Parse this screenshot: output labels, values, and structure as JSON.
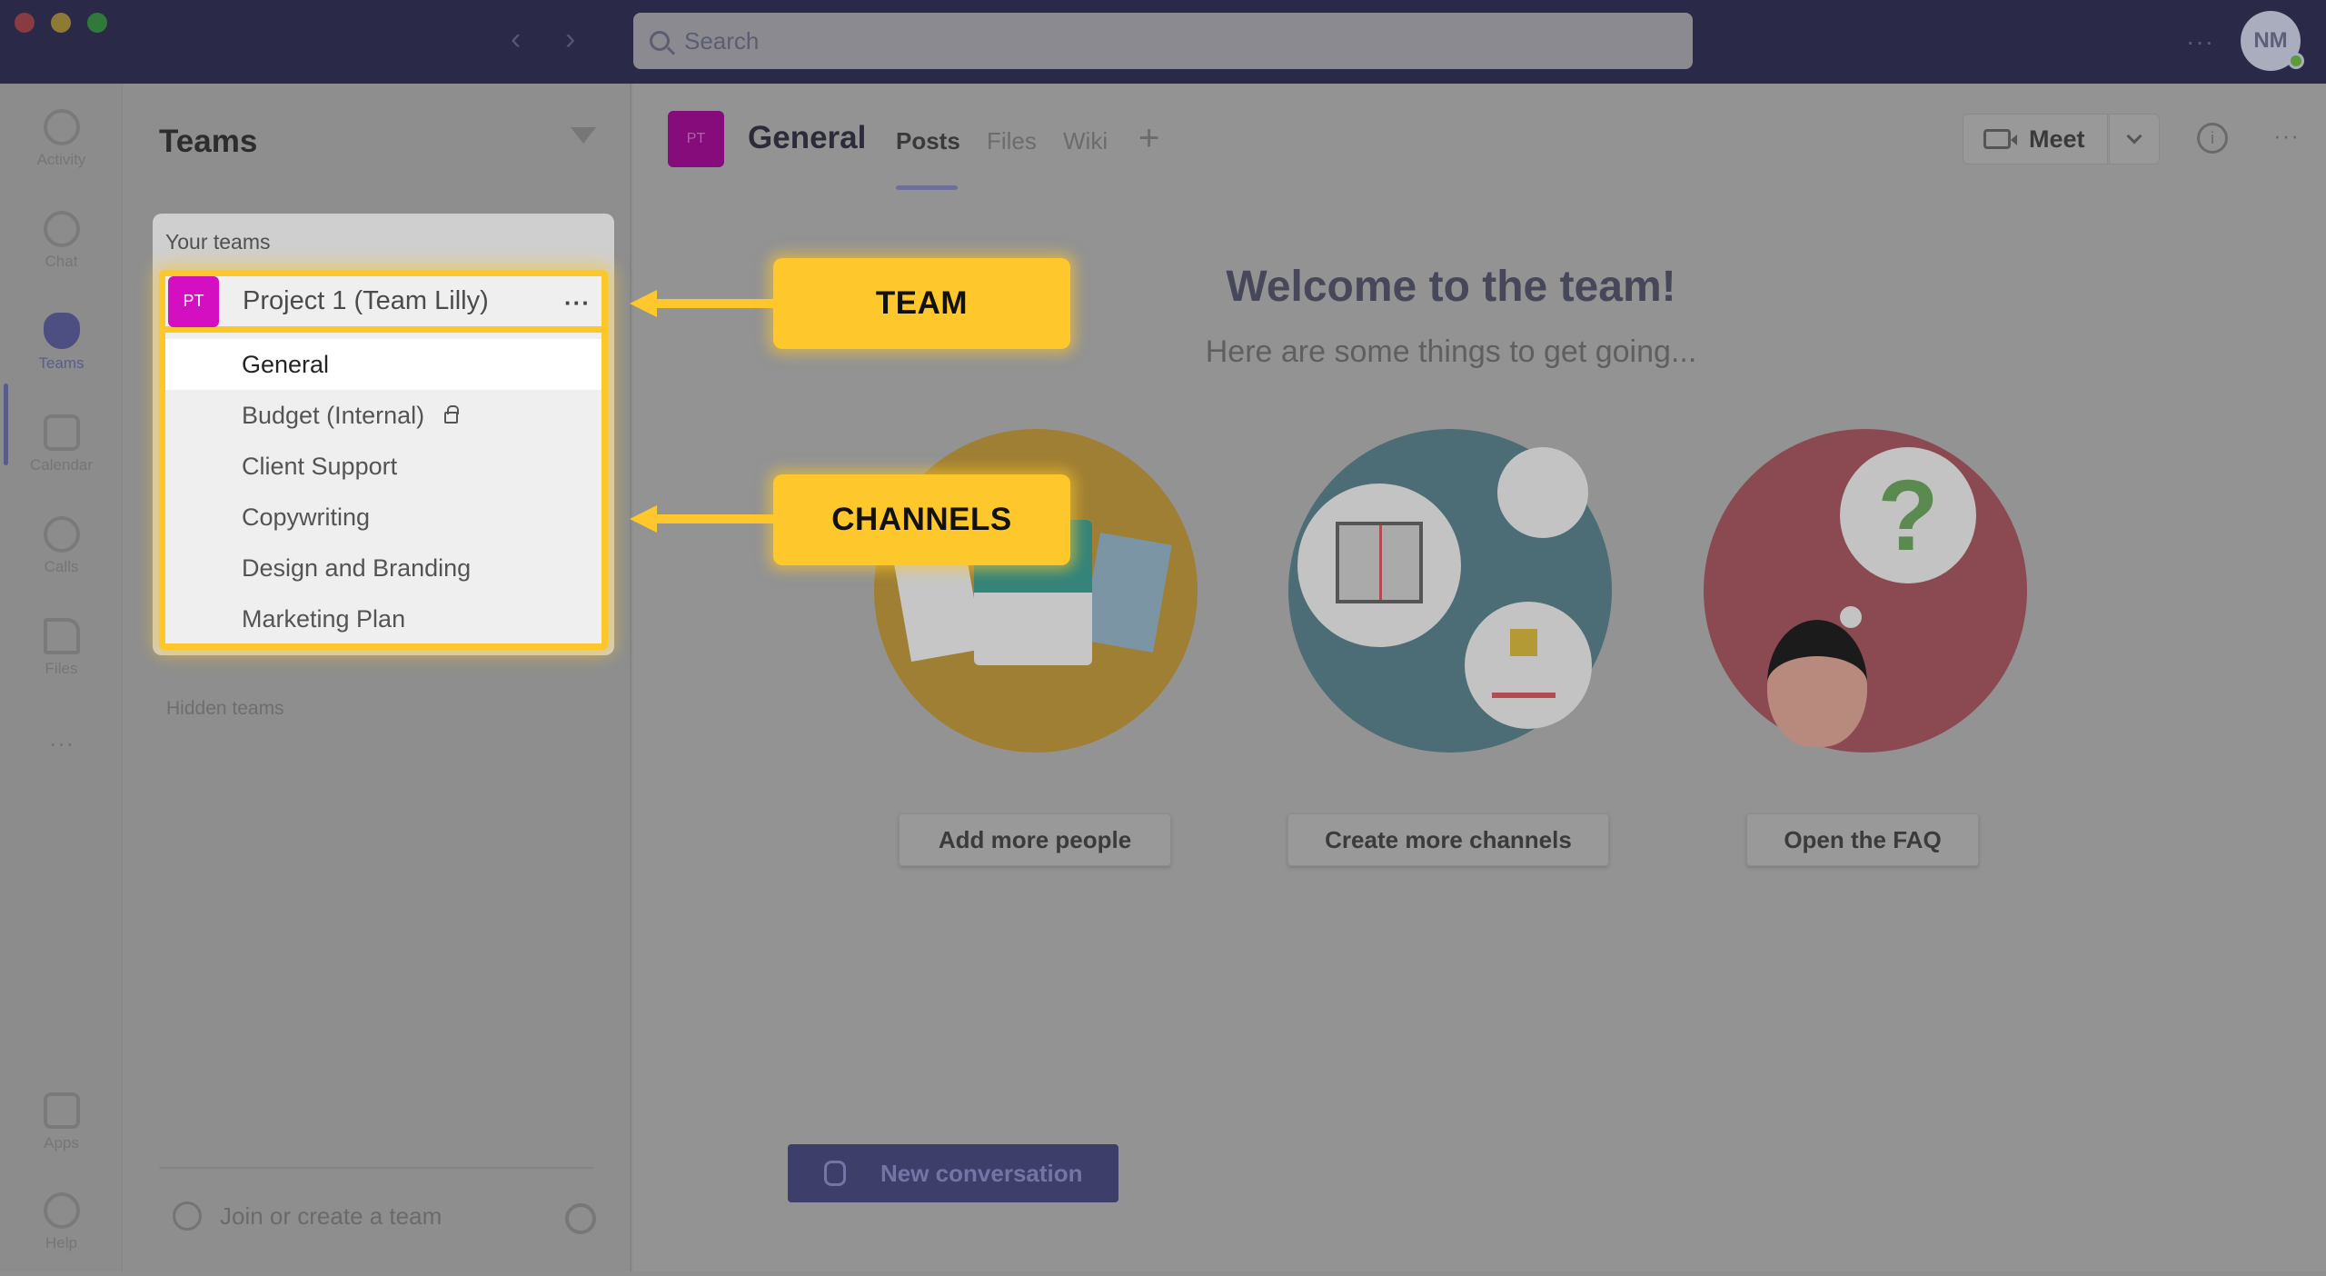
{
  "titlebar": {
    "search_placeholder": "Search",
    "nav_back": "‹",
    "nav_forward": "›",
    "more": "···",
    "avatar_initials": "NM"
  },
  "rail": {
    "items": [
      {
        "label": "Activity",
        "icon": "bell-icon"
      },
      {
        "label": "Chat",
        "icon": "chat-icon"
      },
      {
        "label": "Teams",
        "icon": "teams-icon",
        "active": true
      },
      {
        "label": "Calendar",
        "icon": "calendar-icon"
      },
      {
        "label": "Calls",
        "icon": "phone-icon"
      },
      {
        "label": "Files",
        "icon": "file-icon"
      }
    ],
    "more": "···",
    "bottom_items": [
      {
        "label": "Apps",
        "icon": "apps-icon"
      },
      {
        "label": "Help",
        "icon": "help-icon"
      }
    ]
  },
  "teams_panel": {
    "title": "Teams",
    "section_label": "Your teams",
    "team": {
      "initials": "PT",
      "name": "Project 1 (Team Lilly)",
      "more": "···",
      "avatar_color": "#d40fc2"
    },
    "channels": [
      {
        "name": "General",
        "active": true,
        "locked": false
      },
      {
        "name": "Budget (Internal)",
        "active": false,
        "locked": true
      },
      {
        "name": "Client Support",
        "active": false,
        "locked": false
      },
      {
        "name": "Copywriting",
        "active": false,
        "locked": false
      },
      {
        "name": "Design and Branding",
        "active": false,
        "locked": false
      },
      {
        "name": "Marketing Plan",
        "active": false,
        "locked": false
      }
    ],
    "hidden_teams": "Hidden teams",
    "join_create": "Join or create a team"
  },
  "main": {
    "channel_initials": "PT",
    "channel_title": "General",
    "tabs": [
      {
        "label": "Posts",
        "active": true
      },
      {
        "label": "Files",
        "active": false
      },
      {
        "label": "Wiki",
        "active": false
      }
    ],
    "add_tab": "+",
    "meet_label": "Meet",
    "more": "···",
    "info": "i",
    "welcome_title": "Welcome to the team!",
    "welcome_subtitle": "Here are some things to get going...",
    "question_mark": "?",
    "actions": [
      "Add more people",
      "Create more channels",
      "Open the FAQ"
    ],
    "new_conversation": "New conversation"
  },
  "callouts": {
    "team": "TEAM",
    "channels": "CHANNELS",
    "color": "#fec72b"
  }
}
